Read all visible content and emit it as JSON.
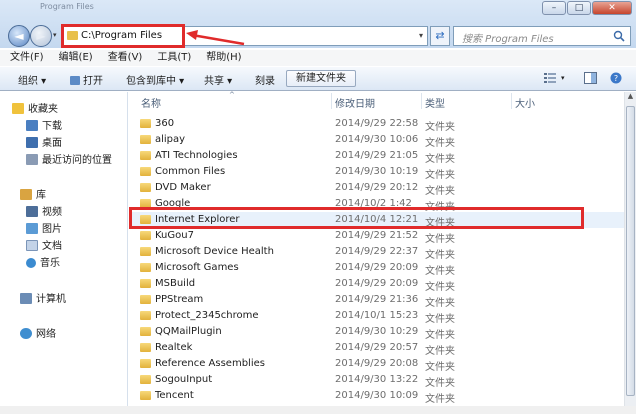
{
  "window": {
    "title": "Program Files",
    "controls": [
      "–",
      "□",
      "✕"
    ]
  },
  "address": {
    "path": "C:\\Program Files",
    "dropdown": "▾"
  },
  "nav": {
    "back": "◄",
    "forward": "►",
    "dropdown": "▾"
  },
  "refresh": "⇄",
  "search": {
    "placeholder": "搜索 Program Files"
  },
  "menu": [
    "文件(F)",
    "编辑(E)",
    "查看(V)",
    "工具(T)",
    "帮助(H)"
  ],
  "toolbar": {
    "organize": "组织 ▾",
    "open": "打开",
    "include_in_library": "包含到库中 ▾",
    "share": "共享 ▾",
    "burn": "刻录",
    "new_folder": "新建文件夹"
  },
  "sidebar": {
    "favorites": {
      "label": "收藏夹",
      "items": [
        "下载",
        "桌面",
        "最近访问的位置"
      ]
    },
    "libraries": {
      "label": "库",
      "items": [
        "视频",
        "图片",
        "文档",
        "音乐"
      ]
    },
    "computer": "计算机",
    "network": "网络"
  },
  "columns": {
    "name": "名称",
    "date": "修改日期",
    "type": "类型",
    "size": "大小"
  },
  "files": [
    {
      "name": "360",
      "date": "2014/9/29 22:58",
      "type": "文件夹"
    },
    {
      "name": "alipay",
      "date": "2014/9/30 10:06",
      "type": "文件夹"
    },
    {
      "name": "ATI Technologies",
      "date": "2014/9/29 21:05",
      "type": "文件夹"
    },
    {
      "name": "Common Files",
      "date": "2014/9/30 10:19",
      "type": "文件夹"
    },
    {
      "name": "DVD Maker",
      "date": "2014/9/29 20:12",
      "type": "文件夹"
    },
    {
      "name": "Google",
      "date": "2014/10/2 1:42",
      "type": "文件夹"
    },
    {
      "name": "Internet Explorer",
      "date": "2014/10/4 12:21",
      "type": "文件夹"
    },
    {
      "name": "KuGou7",
      "date": "2014/9/29 21:52",
      "type": "文件夹"
    },
    {
      "name": "Microsoft Device Health",
      "date": "2014/9/29 22:37",
      "type": "文件夹"
    },
    {
      "name": "Microsoft Games",
      "date": "2014/9/29 20:09",
      "type": "文件夹"
    },
    {
      "name": "MSBuild",
      "date": "2014/9/29 20:09",
      "type": "文件夹"
    },
    {
      "name": "PPStream",
      "date": "2014/9/29 21:36",
      "type": "文件夹"
    },
    {
      "name": "Protect_2345chrome",
      "date": "2014/10/1 15:23",
      "type": "文件夹"
    },
    {
      "name": "QQMailPlugin",
      "date": "2014/9/30 10:29",
      "type": "文件夹"
    },
    {
      "name": "Realtek",
      "date": "2014/9/29 20:57",
      "type": "文件夹"
    },
    {
      "name": "Reference Assemblies",
      "date": "2014/9/29 20:08",
      "type": "文件夹"
    },
    {
      "name": "SogouInput",
      "date": "2014/9/30 13:22",
      "type": "文件夹"
    },
    {
      "name": "Tencent",
      "date": "2014/9/30 10:09",
      "type": "文件夹"
    }
  ],
  "colors": {
    "annotation_red": "#e02b2b",
    "selection": "#e8f1fb"
  }
}
